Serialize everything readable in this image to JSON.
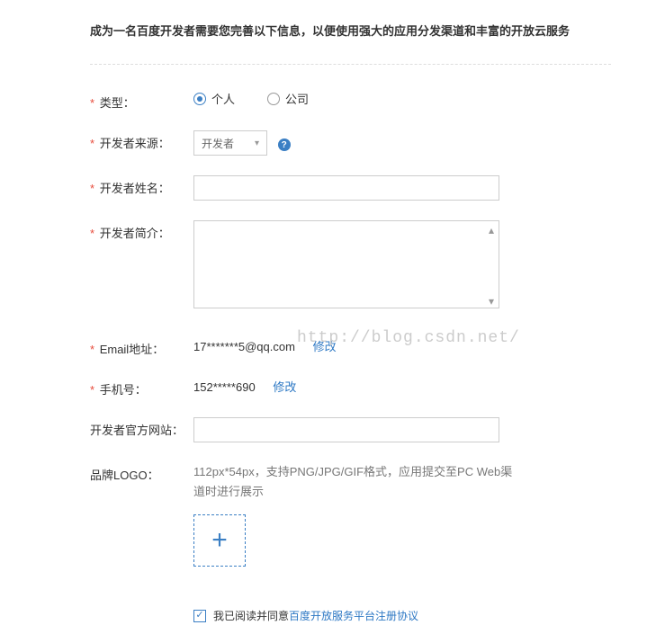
{
  "header": {
    "title": "成为一名百度开发者需要您完善以下信息，以便使用强大的应用分发渠道和丰富的开放云服务"
  },
  "labels": {
    "type": "类型：",
    "source": "开发者来源：",
    "name": "开发者姓名：",
    "intro": "开发者简介：",
    "email": "Email地址：",
    "phone": "手机号：",
    "website": "开发者官方网站：",
    "logo": "品牌LOGO："
  },
  "type_options": {
    "personal": "个人",
    "company": "公司"
  },
  "source_select": {
    "value": "开发者"
  },
  "email": {
    "value": "17*******5@qq.com",
    "action": "修改"
  },
  "phone": {
    "value": "152*****690",
    "action": "修改"
  },
  "logo_hint": "112px*54px，支持PNG/JPG/GIF格式，应用提交至PC Web渠道时进行展示",
  "agreement": {
    "prefix": "我已阅读并同意",
    "link": "百度开放服务平台注册协议"
  },
  "watermark": "http://blog.csdn.net/"
}
